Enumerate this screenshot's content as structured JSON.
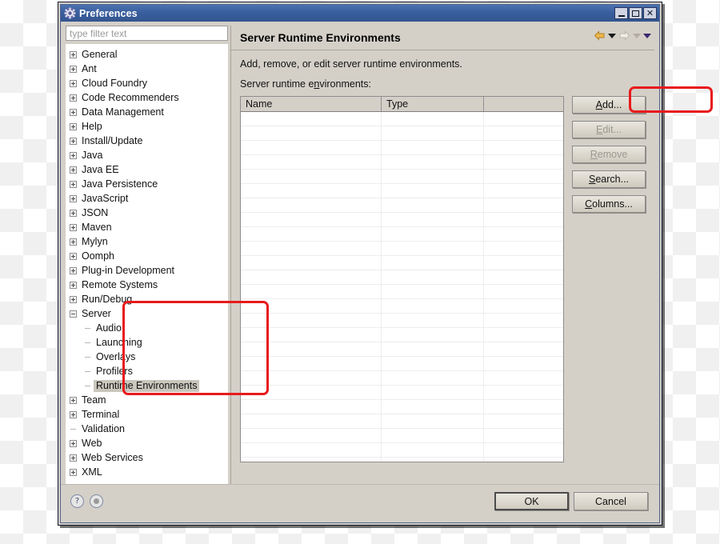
{
  "window": {
    "title": "Preferences",
    "icon": "gear-icon",
    "minimize_label": "Minimize",
    "maximize_label": "Maximize",
    "close_label": "✕"
  },
  "filter": {
    "placeholder": "type filter text",
    "value": ""
  },
  "tree": {
    "items": [
      {
        "label": "General",
        "state": "collapsed",
        "level": 0
      },
      {
        "label": "Ant",
        "state": "collapsed",
        "level": 0
      },
      {
        "label": "Cloud Foundry",
        "state": "collapsed",
        "level": 0
      },
      {
        "label": "Code Recommenders",
        "state": "collapsed",
        "level": 0
      },
      {
        "label": "Data Management",
        "state": "collapsed",
        "level": 0
      },
      {
        "label": "Help",
        "state": "collapsed",
        "level": 0
      },
      {
        "label": "Install/Update",
        "state": "collapsed",
        "level": 0
      },
      {
        "label": "Java",
        "state": "collapsed",
        "level": 0
      },
      {
        "label": "Java EE",
        "state": "collapsed",
        "level": 0
      },
      {
        "label": "Java Persistence",
        "state": "collapsed",
        "level": 0
      },
      {
        "label": "JavaScript",
        "state": "collapsed",
        "level": 0
      },
      {
        "label": "JSON",
        "state": "collapsed",
        "level": 0
      },
      {
        "label": "Maven",
        "state": "collapsed",
        "level": 0
      },
      {
        "label": "Mylyn",
        "state": "collapsed",
        "level": 0
      },
      {
        "label": "Oomph",
        "state": "collapsed",
        "level": 0
      },
      {
        "label": "Plug-in Development",
        "state": "collapsed",
        "level": 0
      },
      {
        "label": "Remote Systems",
        "state": "collapsed",
        "level": 0
      },
      {
        "label": "Run/Debug",
        "state": "collapsed",
        "level": 0
      },
      {
        "label": "Server",
        "state": "expanded",
        "level": 0
      },
      {
        "label": "Audio",
        "state": "leaf",
        "level": 1
      },
      {
        "label": "Launching",
        "state": "leaf",
        "level": 1
      },
      {
        "label": "Overlays",
        "state": "leaf",
        "level": 1
      },
      {
        "label": "Profilers",
        "state": "leaf",
        "level": 1
      },
      {
        "label": "Runtime Environments",
        "state": "leaf",
        "level": 1,
        "selected": true
      },
      {
        "label": "Team",
        "state": "collapsed",
        "level": 0
      },
      {
        "label": "Terminal",
        "state": "collapsed",
        "level": 0
      },
      {
        "label": "Validation",
        "state": "leaf",
        "level": 0
      },
      {
        "label": "Web",
        "state": "collapsed",
        "level": 0
      },
      {
        "label": "Web Services",
        "state": "collapsed",
        "level": 0
      },
      {
        "label": "XML",
        "state": "collapsed",
        "level": 0
      }
    ]
  },
  "page": {
    "title": "Server Runtime Environments",
    "description": "Add, remove, or edit server runtime environments.",
    "table_label_pre": "Server runtime e",
    "table_label_mnemonic": "n",
    "table_label_post": "vironments:"
  },
  "nav": {
    "back_icon": "back-arrow-icon",
    "back_menu_icon": "chevron-down-icon",
    "forward_icon": "forward-arrow-icon",
    "forward_menu_icon": "chevron-down-icon",
    "view_menu_icon": "chevron-down-icon"
  },
  "table": {
    "columns": [
      "Name",
      "Type",
      ""
    ],
    "rows": [],
    "empty_row_count": 25
  },
  "side_buttons": [
    {
      "name": "add-button",
      "pre": "",
      "mnemonic": "A",
      "post": "dd...",
      "enabled": true,
      "highlighted": true
    },
    {
      "name": "edit-button",
      "pre": "",
      "mnemonic": "E",
      "post": "dit...",
      "enabled": false,
      "highlighted": false
    },
    {
      "name": "remove-button",
      "pre": "",
      "mnemonic": "R",
      "post": "emove",
      "enabled": false,
      "highlighted": false
    },
    {
      "name": "search-button",
      "pre": "",
      "mnemonic": "S",
      "post": "earch...",
      "enabled": true,
      "highlighted": false
    },
    {
      "name": "columns-button",
      "pre": "",
      "mnemonic": "C",
      "post": "olumns...",
      "enabled": true,
      "highlighted": false
    }
  ],
  "footer": {
    "help_icon": "?",
    "apply_icon": "circle-dot-icon",
    "ok_label": "OK",
    "cancel_label": "Cancel"
  },
  "colors": {
    "titlebar": "#3a5f9e",
    "dialog_bg": "#d4d0c8",
    "annotation_red": "#e81a1c",
    "selection_gray": "#c9c6bc",
    "back_arrow": "#e8b33a",
    "forward_arrow": "#cfc8ba"
  }
}
